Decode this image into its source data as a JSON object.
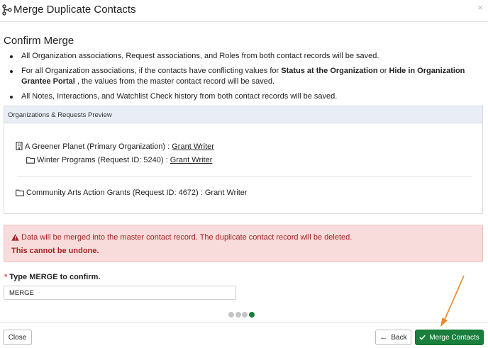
{
  "dialog": {
    "title": "Merge Duplicate Contacts",
    "close_symbol": "×"
  },
  "confirm": {
    "heading": "Confirm Merge",
    "bullet1": "All Organization associations, Request associations, and Roles from both contact records will be saved.",
    "bullet2_part1": "For all Organization associations, if the contacts have conflicting values for ",
    "bullet2_bold1": "Status at the Organization",
    "bullet2_part2": " or ",
    "bullet2_bold2": "Hide in Organization Grantee Portal",
    "bullet2_part3": " , the values from the master contact record will be saved.",
    "bullet3": "All Notes, Interactions, and Watchlist Check history from both contact records will be saved."
  },
  "preview": {
    "header": "Organizations & Requests Preview",
    "org1_name": "A Greener Planet (Primary Organization) : ",
    "org1_role": "Grant Writer",
    "request1_name": "Winter Programs (Request ID: 5240) : ",
    "request1_role": "Grant Writer",
    "request2_text": "Community Arts Action Grants (Request ID: 4672) : Grant Writer"
  },
  "warning": {
    "message": "Data will be merged into the master contact record. The duplicate contact record will be deleted.",
    "emphasis": "This cannot be undone."
  },
  "merge_input": {
    "required_mark": "*",
    "label": "Type MERGE to confirm.",
    "value": "MERGE"
  },
  "stepper": {
    "total_steps": 4,
    "current_step": 4
  },
  "footer": {
    "close_label": "Close",
    "back_label": "Back",
    "merge_label": "Merge Contacts"
  },
  "colors": {
    "primary_green": "#1a7f3c",
    "danger_text": "#a32424",
    "danger_bg": "#f8dcdc",
    "annotation_arrow": "#e8892b"
  },
  "icons": {
    "title": "merge-icon",
    "organization": "building-icon",
    "request": "folder-icon",
    "warning": "warning-triangle-icon",
    "back": "arrow-left-icon",
    "merge": "check-icon"
  }
}
